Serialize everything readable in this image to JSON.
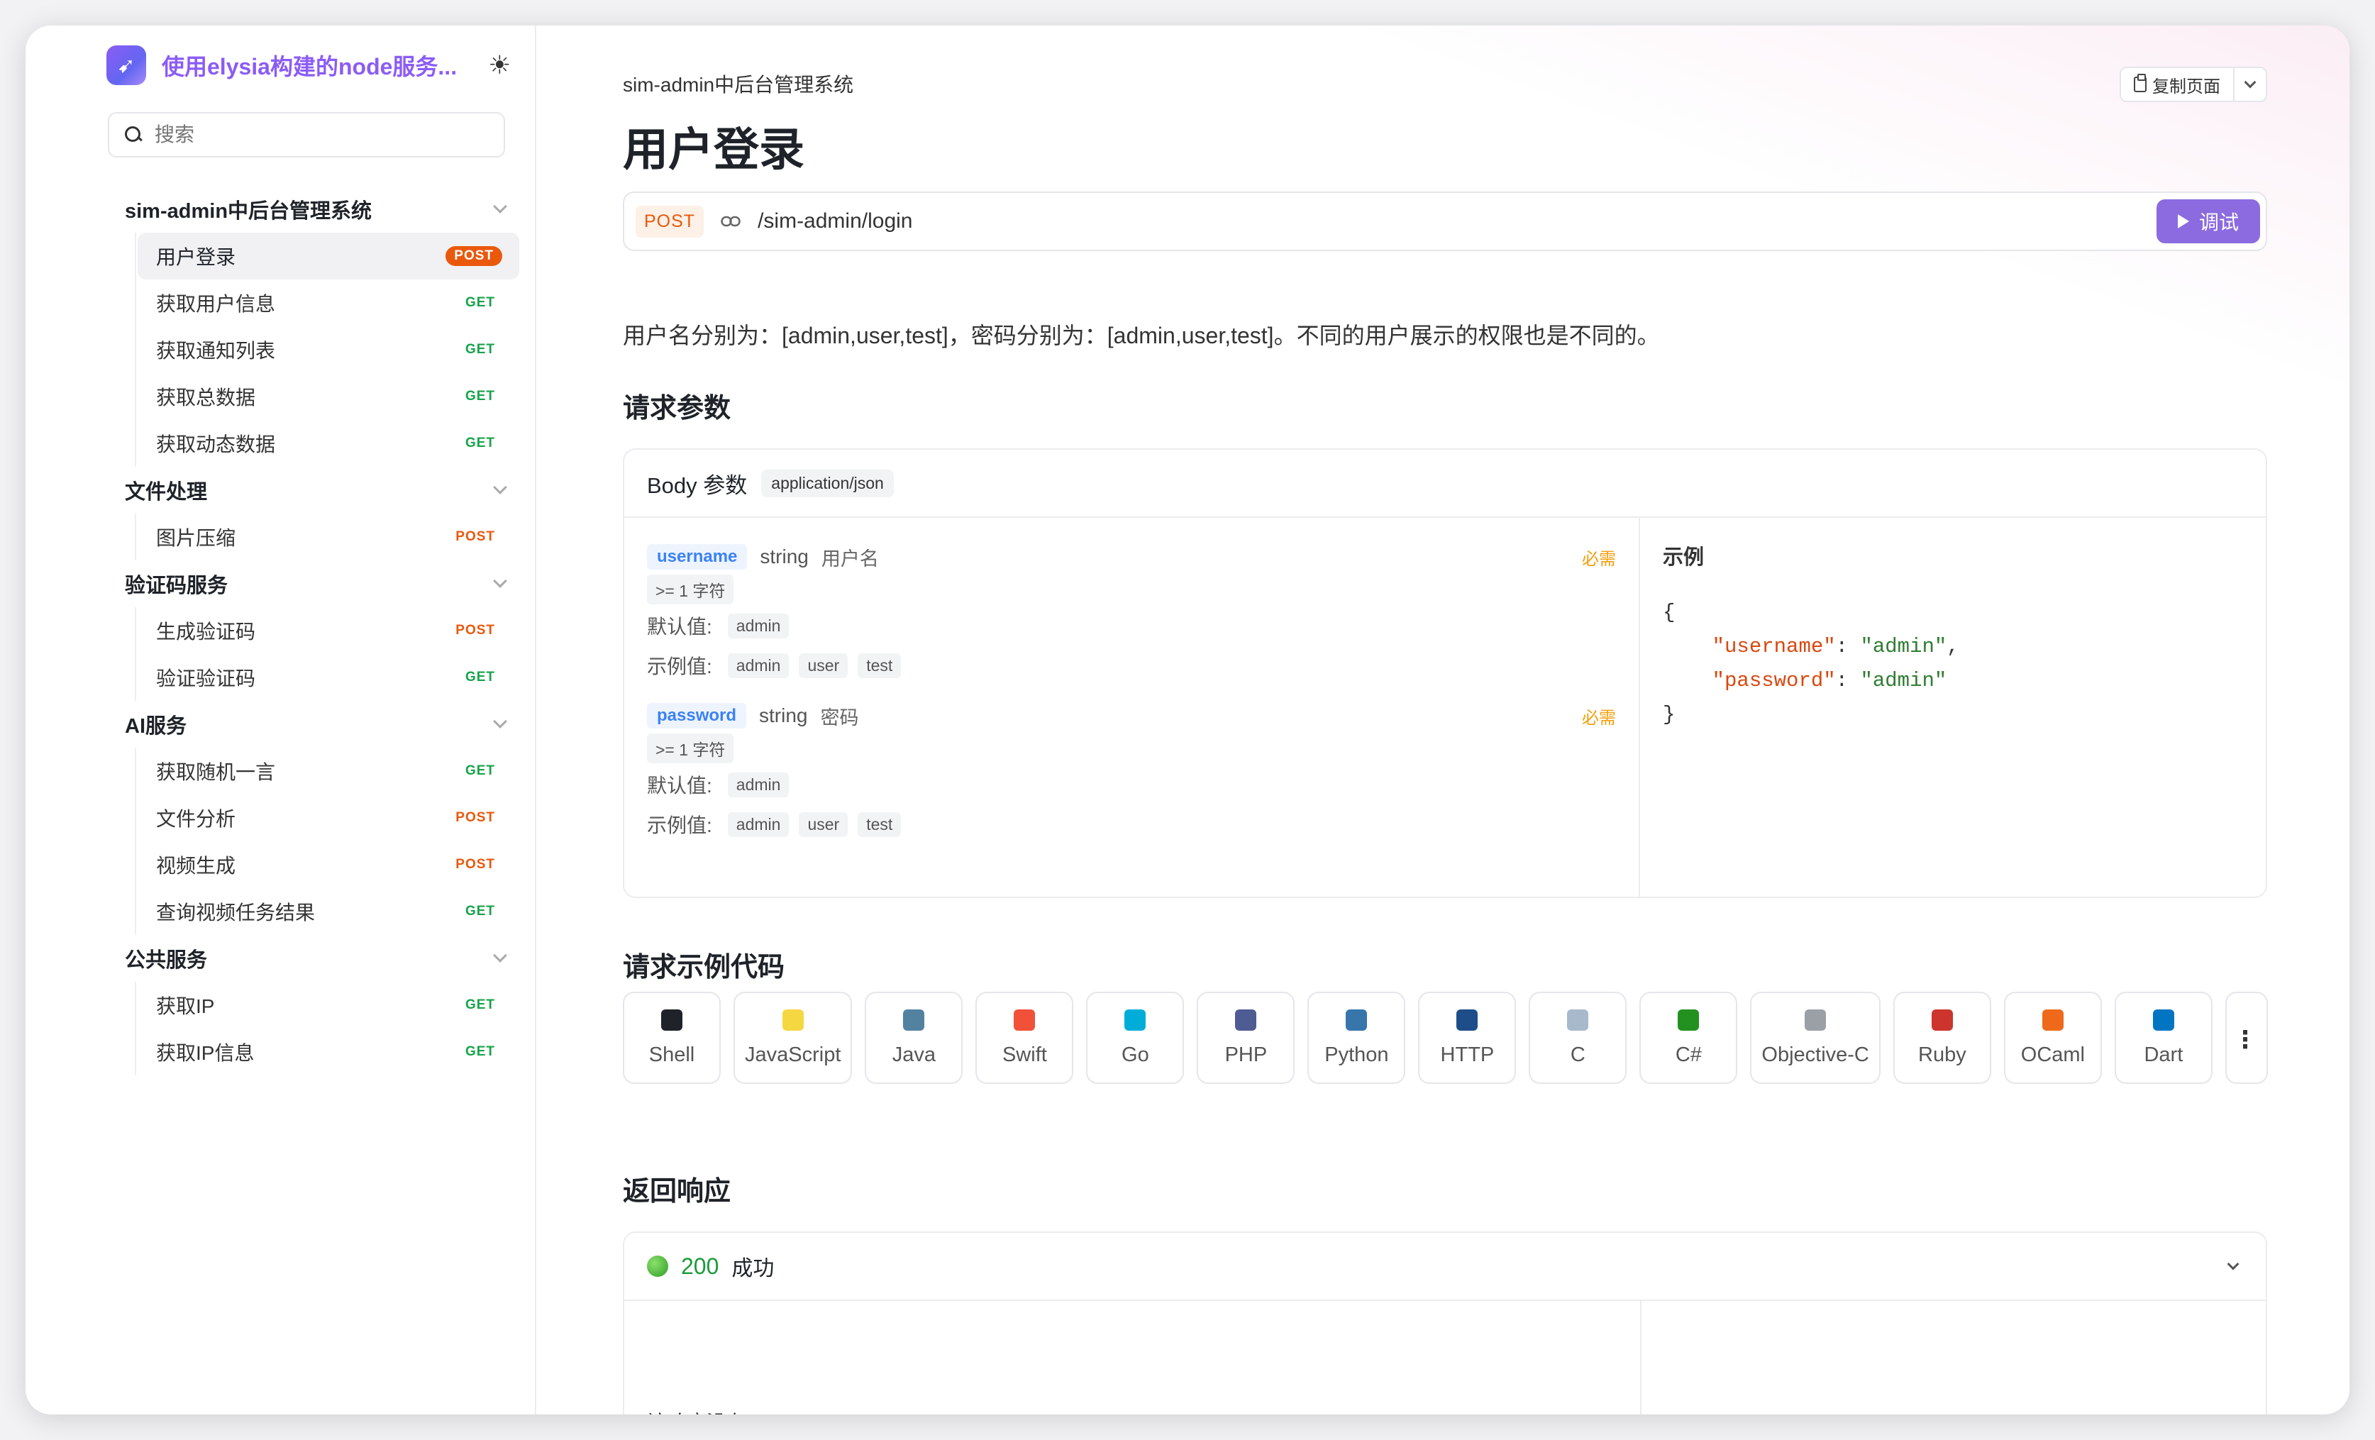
{
  "app": {
    "title": "使用elysia构建的node服务...",
    "logo": "rocket-logo",
    "theme_icon": "sun-icon"
  },
  "search": {
    "placeholder": "搜索"
  },
  "sidebar": {
    "groups": [
      {
        "label": "sim-admin中后台管理系统",
        "items": [
          {
            "label": "用户登录",
            "method": "POST",
            "active": true
          },
          {
            "label": "获取用户信息",
            "method": "GET"
          },
          {
            "label": "获取通知列表",
            "method": "GET"
          },
          {
            "label": "获取总数据",
            "method": "GET"
          },
          {
            "label": "获取动态数据",
            "method": "GET"
          }
        ]
      },
      {
        "label": "文件处理",
        "items": [
          {
            "label": "图片压缩",
            "method": "POST"
          }
        ]
      },
      {
        "label": "验证码服务",
        "items": [
          {
            "label": "生成验证码",
            "method": "POST"
          },
          {
            "label": "验证验证码",
            "method": "GET"
          }
        ]
      },
      {
        "label": "AI服务",
        "items": [
          {
            "label": "获取随机一言",
            "method": "GET"
          },
          {
            "label": "文件分析",
            "method": "POST"
          },
          {
            "label": "视频生成",
            "method": "POST"
          },
          {
            "label": "查询视频任务结果",
            "method": "GET"
          }
        ]
      },
      {
        "label": "公共服务",
        "items": [
          {
            "label": "获取IP",
            "method": "GET"
          },
          {
            "label": "获取IP信息",
            "method": "GET"
          }
        ]
      }
    ]
  },
  "main": {
    "breadcrumb": "sim-admin中后台管理系统",
    "copy_label": "复制页面",
    "title": "用户登录",
    "endpoint": {
      "method": "POST",
      "path": "/sim-admin/login",
      "debug_label": "调试"
    },
    "description": "用户名分别为：[admin,user,test]，密码分别为：[admin,user,test]。不同的用户展示的权限也是不同的。",
    "request_params_title": "请求参数",
    "body": {
      "title": "Body 参数",
      "content_type": "application/json",
      "default_label": "默认值:",
      "example_values_label": "示例值:",
      "params": [
        {
          "name": "username",
          "type": "string",
          "desc": "用户名",
          "required": "必需",
          "constraint": ">= 1 字符",
          "default": "admin",
          "examples": [
            "admin",
            "user",
            "test"
          ]
        },
        {
          "name": "password",
          "type": "string",
          "desc": "密码",
          "required": "必需",
          "constraint": ">= 1 字符",
          "default": "admin",
          "examples": [
            "admin",
            "user",
            "test"
          ]
        }
      ],
      "example_title": "示例",
      "example_lines": {
        "open": "{",
        "k1": "\"username\"",
        "v1": "\"admin\"",
        "k2": "\"password\"",
        "v2": "\"admin\"",
        "close": "}"
      }
    },
    "code_samples_title": "请求示例代码",
    "languages": [
      {
        "label": "Shell",
        "icon": "terminal-icon",
        "color": "#1f2329"
      },
      {
        "label": "JavaScript",
        "icon": "javascript-icon",
        "color": "#f5d742"
      },
      {
        "label": "Java",
        "icon": "java-icon",
        "color": "#5382a1"
      },
      {
        "label": "Swift",
        "icon": "swift-icon",
        "color": "#f05138"
      },
      {
        "label": "Go",
        "icon": "go-icon",
        "color": "#00add8"
      },
      {
        "label": "PHP",
        "icon": "php-icon",
        "color": "#4f5b93"
      },
      {
        "label": "Python",
        "icon": "python-icon",
        "color": "#3776ab"
      },
      {
        "label": "HTTP",
        "icon": "http-icon",
        "color": "#1d4e89"
      },
      {
        "label": "C",
        "icon": "c-icon",
        "color": "#a8b9cc"
      },
      {
        "label": "C#",
        "icon": "csharp-icon",
        "color": "#239120"
      },
      {
        "label": "Objective-C",
        "icon": "objc-icon",
        "color": "#9aa0a6"
      },
      {
        "label": "Ruby",
        "icon": "ruby-icon",
        "color": "#cc342d"
      },
      {
        "label": "OCaml",
        "icon": "ocaml-icon",
        "color": "#ee6a1a"
      },
      {
        "label": "Dart",
        "icon": "dart-icon",
        "color": "#0175c2"
      }
    ],
    "response_title": "返回响应",
    "response": {
      "code": "200",
      "status": "成功",
      "no_body": "该响应没有 Body"
    }
  },
  "colors": {
    "accent": "#8b5cf6",
    "post": "#ea580c",
    "get": "#16a34a",
    "debug": "#8b6bdf"
  }
}
